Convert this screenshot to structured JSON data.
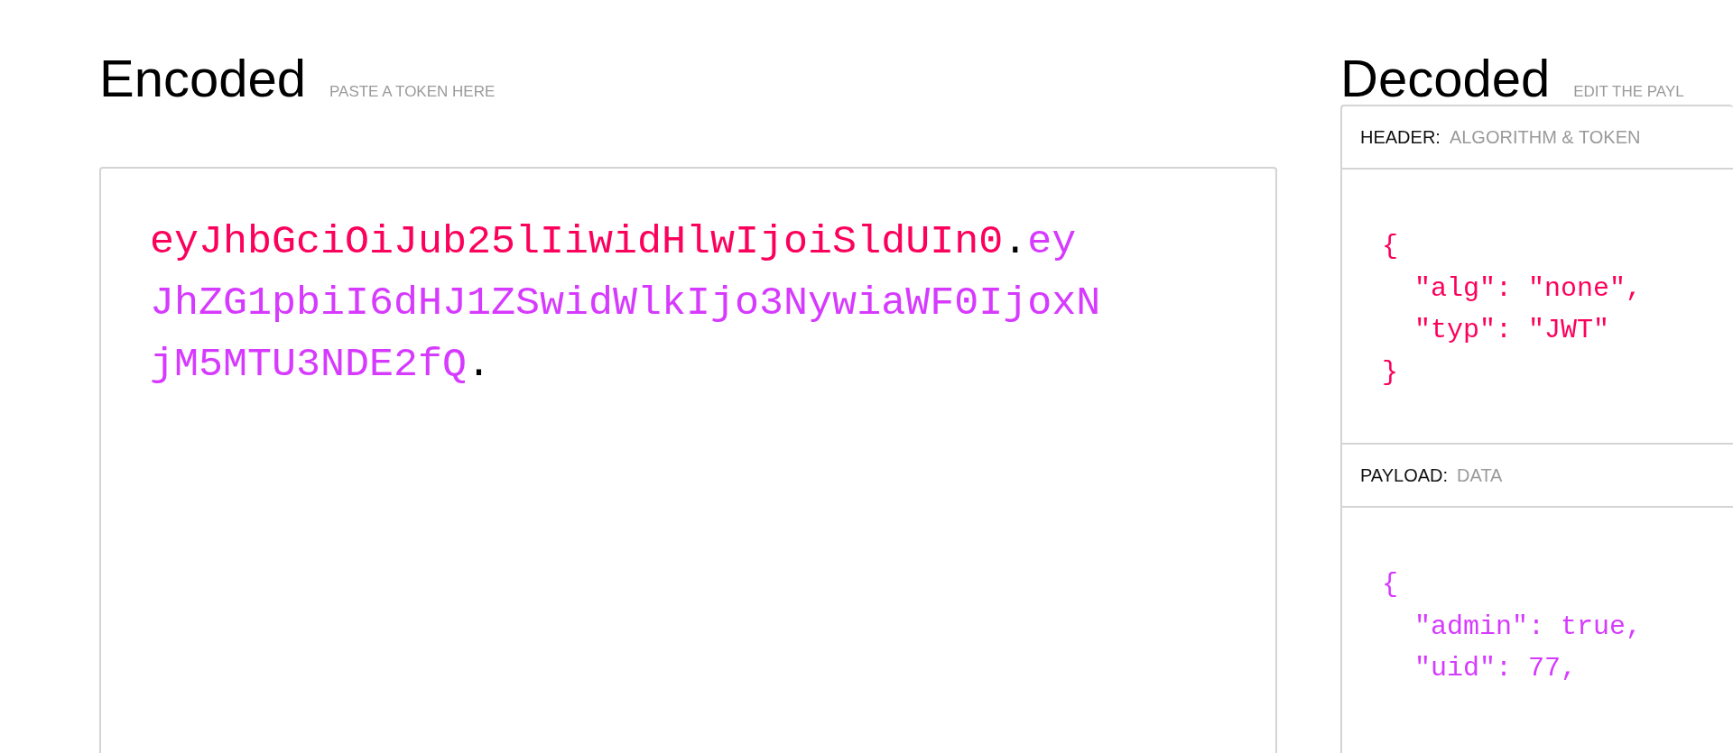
{
  "encoded": {
    "title": "Encoded",
    "hint": "PASTE A TOKEN HERE",
    "token": [
      {
        "kind": "header",
        "text": "eyJhbGciOiJub25lIiwidHlwIjoiSldUIn0"
      },
      {
        "kind": "dot",
        "text": "."
      },
      {
        "kind": "payload",
        "text": "eyJhZG1pbiI6dHJ1ZSwidWlkIjo3NywiaWF0IjoxNjM5MTU3NDE2fQ"
      },
      {
        "kind": "dot",
        "text": "."
      }
    ]
  },
  "decoded": {
    "title": "Decoded",
    "hint": "EDIT THE PAYL",
    "sections": [
      {
        "kind": "header",
        "label": "HEADER:",
        "hint": "ALGORITHM & TOKEN",
        "lines": [
          "{",
          "  \"alg\": \"none\",",
          "  \"typ\": \"JWT\"",
          "}"
        ]
      },
      {
        "kind": "payload",
        "label": "PAYLOAD:",
        "hint": "DATA",
        "lines": [
          "{",
          "  \"admin\": true,",
          "  \"uid\": 77,"
        ]
      }
    ]
  }
}
